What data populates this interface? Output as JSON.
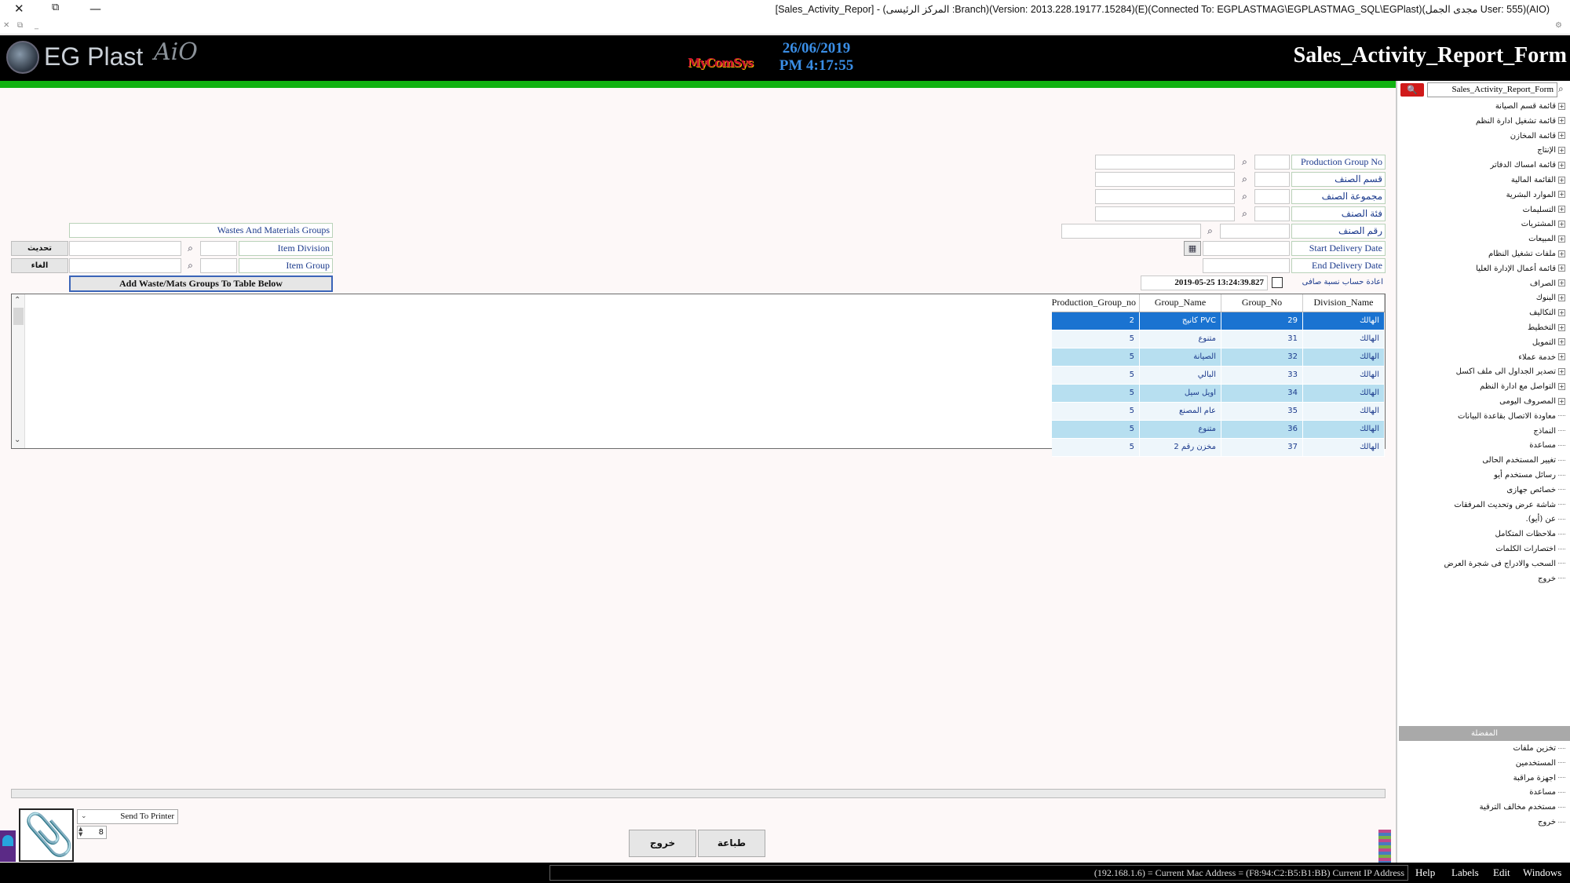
{
  "window": {
    "title": "[Sales_Activity_Repor] - (المركز الرئيسى :Branch)(Version: 2013.228.19177.15284)(E)(Connected To: EGPLASTMAG\\EGPLASTMAG_SQL\\EGPlast)(مجدى الجمل User: 555)(AIO)"
  },
  "header": {
    "logo_text": "EG Plast",
    "logo_suffix": "AiO",
    "brand": "MyComSys",
    "date": "26/06/2019",
    "time": "PM 4:17:55",
    "form_title": "Sales_Activity_Report_Form"
  },
  "menu": {
    "search_value": "Sales_Activity_Report_Form",
    "items": [
      {
        "label": "قائمة قسم الصيانة",
        "expandable": true
      },
      {
        "label": "قائمة تشغيل ادارة النظم",
        "expandable": true
      },
      {
        "label": "قائمة المخازن",
        "expandable": true
      },
      {
        "label": "الإنتاج",
        "expandable": true
      },
      {
        "label": "قائمة امساك الدفاتر",
        "expandable": true
      },
      {
        "label": "القائمة المالية",
        "expandable": true
      },
      {
        "label": "الموارد البشرية",
        "expandable": true
      },
      {
        "label": "التسليمات",
        "expandable": true
      },
      {
        "label": "المشتريات",
        "expandable": true
      },
      {
        "label": "المبيعات",
        "expandable": true
      },
      {
        "label": "ملفات تشغيل النظام",
        "expandable": true
      },
      {
        "label": "قائمة أعمال الإدارة العليا",
        "expandable": true
      },
      {
        "label": "الصراف",
        "expandable": true
      },
      {
        "label": "البنوك",
        "expandable": true
      },
      {
        "label": "التكاليف",
        "expandable": true
      },
      {
        "label": "التخطيط",
        "expandable": true
      },
      {
        "label": "التمويل",
        "expandable": true
      },
      {
        "label": "خدمة عملاء",
        "expandable": true
      },
      {
        "label": "تصدير الجداول الى ملف اكسل",
        "expandable": true
      },
      {
        "label": "التواصل مع ادارة النظم",
        "expandable": true
      },
      {
        "label": "المصروف اليومى",
        "expandable": true
      },
      {
        "label": "معاودة الاتصال بقاعدة البيانات",
        "expandable": false
      },
      {
        "label": "النماذج",
        "expandable": false
      },
      {
        "label": "مساعدة",
        "expandable": false
      },
      {
        "label": "تغيير المستخدم الحالى",
        "expandable": false
      },
      {
        "label": "رسائل مستخدم أيو",
        "expandable": false
      },
      {
        "label": "خصائص جهازى",
        "expandable": false
      },
      {
        "label": "شاشة عرض وتحديث المرفقات",
        "expandable": false
      },
      {
        "label": "عن (أيو).",
        "expandable": false
      },
      {
        "label": "ملاحظات المتكامل",
        "expandable": false
      },
      {
        "label": "اختصارات الكلمات",
        "expandable": false
      },
      {
        "label": "السحب والادراج فى شجرة العرض",
        "expandable": false
      },
      {
        "label": "خروج",
        "expandable": false
      }
    ],
    "favorites_header": "المفضلة",
    "favorites": [
      {
        "label": "تخزين ملفات"
      },
      {
        "label": "المستخدمين"
      },
      {
        "label": "اجهزة مراقبة"
      },
      {
        "label": "مساعدة"
      },
      {
        "label": "مستخدم مخالف الترقية"
      },
      {
        "label": "خروج"
      }
    ]
  },
  "form": {
    "production_group_no": "Production Group No",
    "item_section": "قسم الصنف",
    "item_group_ar": "مجموعة الصنف",
    "item_category": "فئة الصنف",
    "item_number": "رقم الصنف",
    "start_delivery_date": "Start Delivery Date",
    "end_delivery_date": "End Delivery Date",
    "recalc_label": "اعادة حساب نسبة صافى",
    "recalc_timestamp": "2019-05-25 13:24:39.827",
    "wastes_groups": "Wastes And Materials Groups",
    "item_division": "Item Division",
    "item_group": "Item Group",
    "refresh_btn": "تحديث",
    "cancel_btn": "الغاء",
    "add_groups_btn": "Add Waste/Mats Groups To Table Below"
  },
  "grid": {
    "columns": [
      "Division_Name",
      "Group_No",
      "Group_Name",
      "Production_Group_no"
    ],
    "rows": [
      {
        "division": "الهالك",
        "group_no": "29",
        "group_name": "كانيج PVC",
        "prod_group": "2"
      },
      {
        "division": "الهالك",
        "group_no": "31",
        "group_name": "متنوع",
        "prod_group": "5"
      },
      {
        "division": "الهالك",
        "group_no": "32",
        "group_name": "الصيانة",
        "prod_group": "5"
      },
      {
        "division": "الهالك",
        "group_no": "33",
        "group_name": "البالي",
        "prod_group": "5"
      },
      {
        "division": "الهالك",
        "group_no": "34",
        "group_name": "اويل سيل",
        "prod_group": "5"
      },
      {
        "division": "الهالك",
        "group_no": "35",
        "group_name": "عام المصنع",
        "prod_group": "5"
      },
      {
        "division": "الهالك",
        "group_no": "36",
        "group_name": "متنوع",
        "prod_group": "5"
      },
      {
        "division": "الهالك",
        "group_no": "37",
        "group_name": "مخزن رقم 2",
        "prod_group": "5"
      }
    ]
  },
  "bottom": {
    "printer_option": "Send To Printer",
    "copies": "8",
    "exit_btn": "خروج",
    "print_btn": "طباعة"
  },
  "status": {
    "info": "(192.168.1.6) = Current Mac Address = (F8:94:C2:B5:B1:BB) Current IP Address",
    "menu": [
      "Help",
      "Labels",
      "Edit",
      "Windows"
    ]
  }
}
